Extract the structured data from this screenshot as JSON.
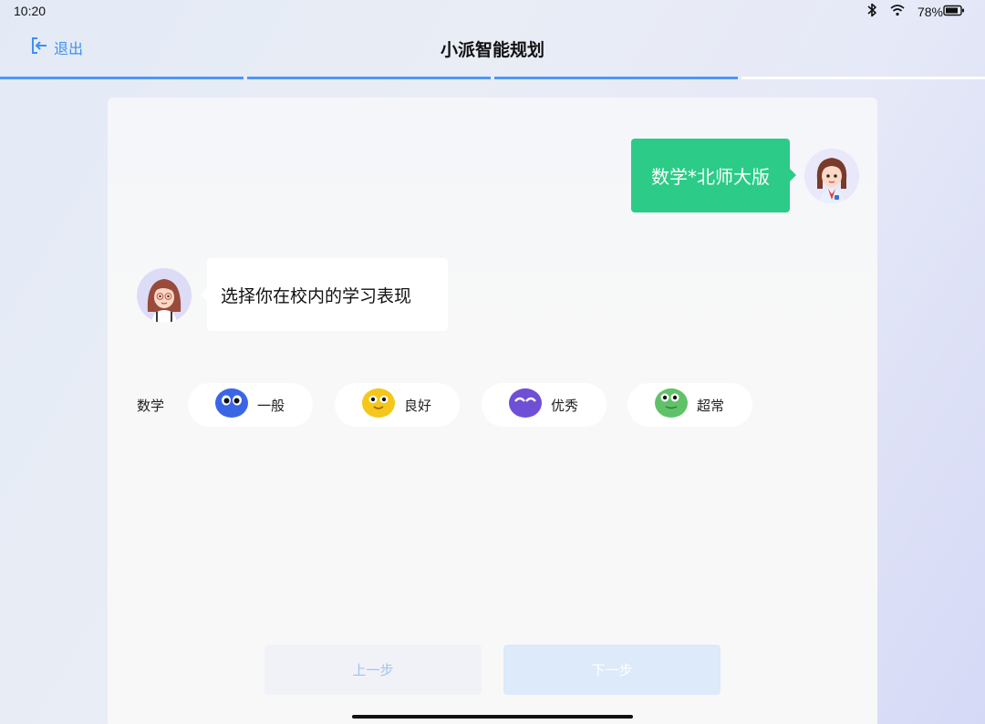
{
  "status": {
    "time": "10:20",
    "battery": "78%"
  },
  "header": {
    "exit_label": "退出",
    "title": "小派智能规划"
  },
  "progress": {
    "completed_steps": 3,
    "total_steps": 4
  },
  "chat": {
    "user_message": "数学*北师大版",
    "bot_message": "选择你在校内的学习表现"
  },
  "selection": {
    "subject": "数学",
    "options": [
      {
        "label": "一般",
        "color": "#3a66e6"
      },
      {
        "label": "良好",
        "color": "#f5c71a"
      },
      {
        "label": "优秀",
        "color": "#6f4fd6"
      },
      {
        "label": "超常",
        "color": "#5fc269"
      }
    ]
  },
  "footer": {
    "prev_label": "上一步",
    "next_label": "下一步"
  },
  "colors": {
    "accent": "#4f97f5",
    "user_bubble": "#2ccb88"
  }
}
